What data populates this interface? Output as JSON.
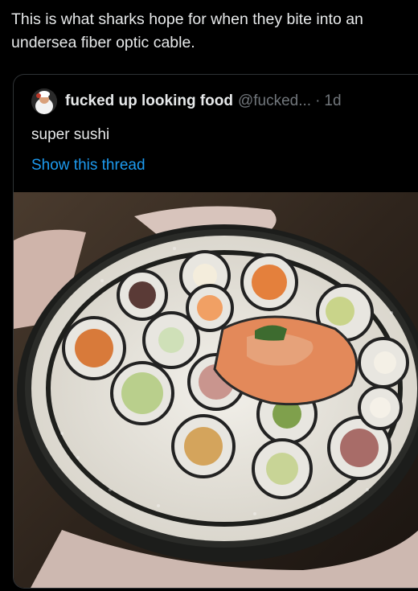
{
  "tweet": {
    "text": "This is what sharks hope for when they bite into an undersea fiber optic cable."
  },
  "quoted_tweet": {
    "author_name": "fucked up looking food",
    "author_handle": "@fucked...",
    "separator": "·",
    "timestamp": "1d",
    "text": "super sushi",
    "thread_link": "Show this thread",
    "avatar_icon": "chef-avatar-icon",
    "media_icon": "sushi-roll-photo"
  },
  "colors": {
    "background": "#000000",
    "text": "#e7e9ea",
    "secondary_text": "#71767b",
    "link": "#1d9bf0",
    "border": "#2f3336"
  }
}
